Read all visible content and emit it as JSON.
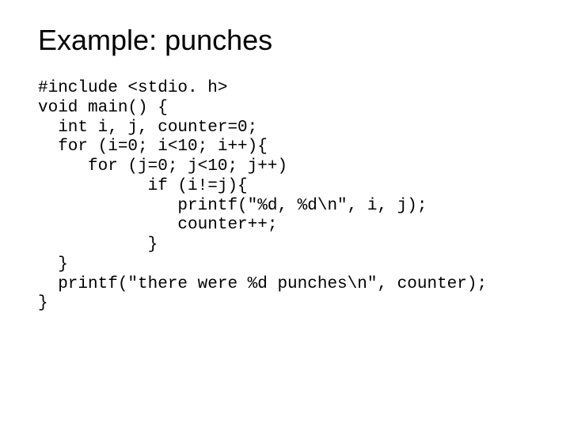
{
  "slide": {
    "title": "Example: punches",
    "code": "#include <stdio. h>\nvoid main() {\n  int i, j, counter=0;\n  for (i=0; i<10; i++){\n     for (j=0; j<10; j++)\n           if (i!=j){\n              printf(\"%d, %d\\n\", i, j);\n              counter++;\n           }\n  }\n  printf(\"there were %d punches\\n\", counter);\n}"
  }
}
